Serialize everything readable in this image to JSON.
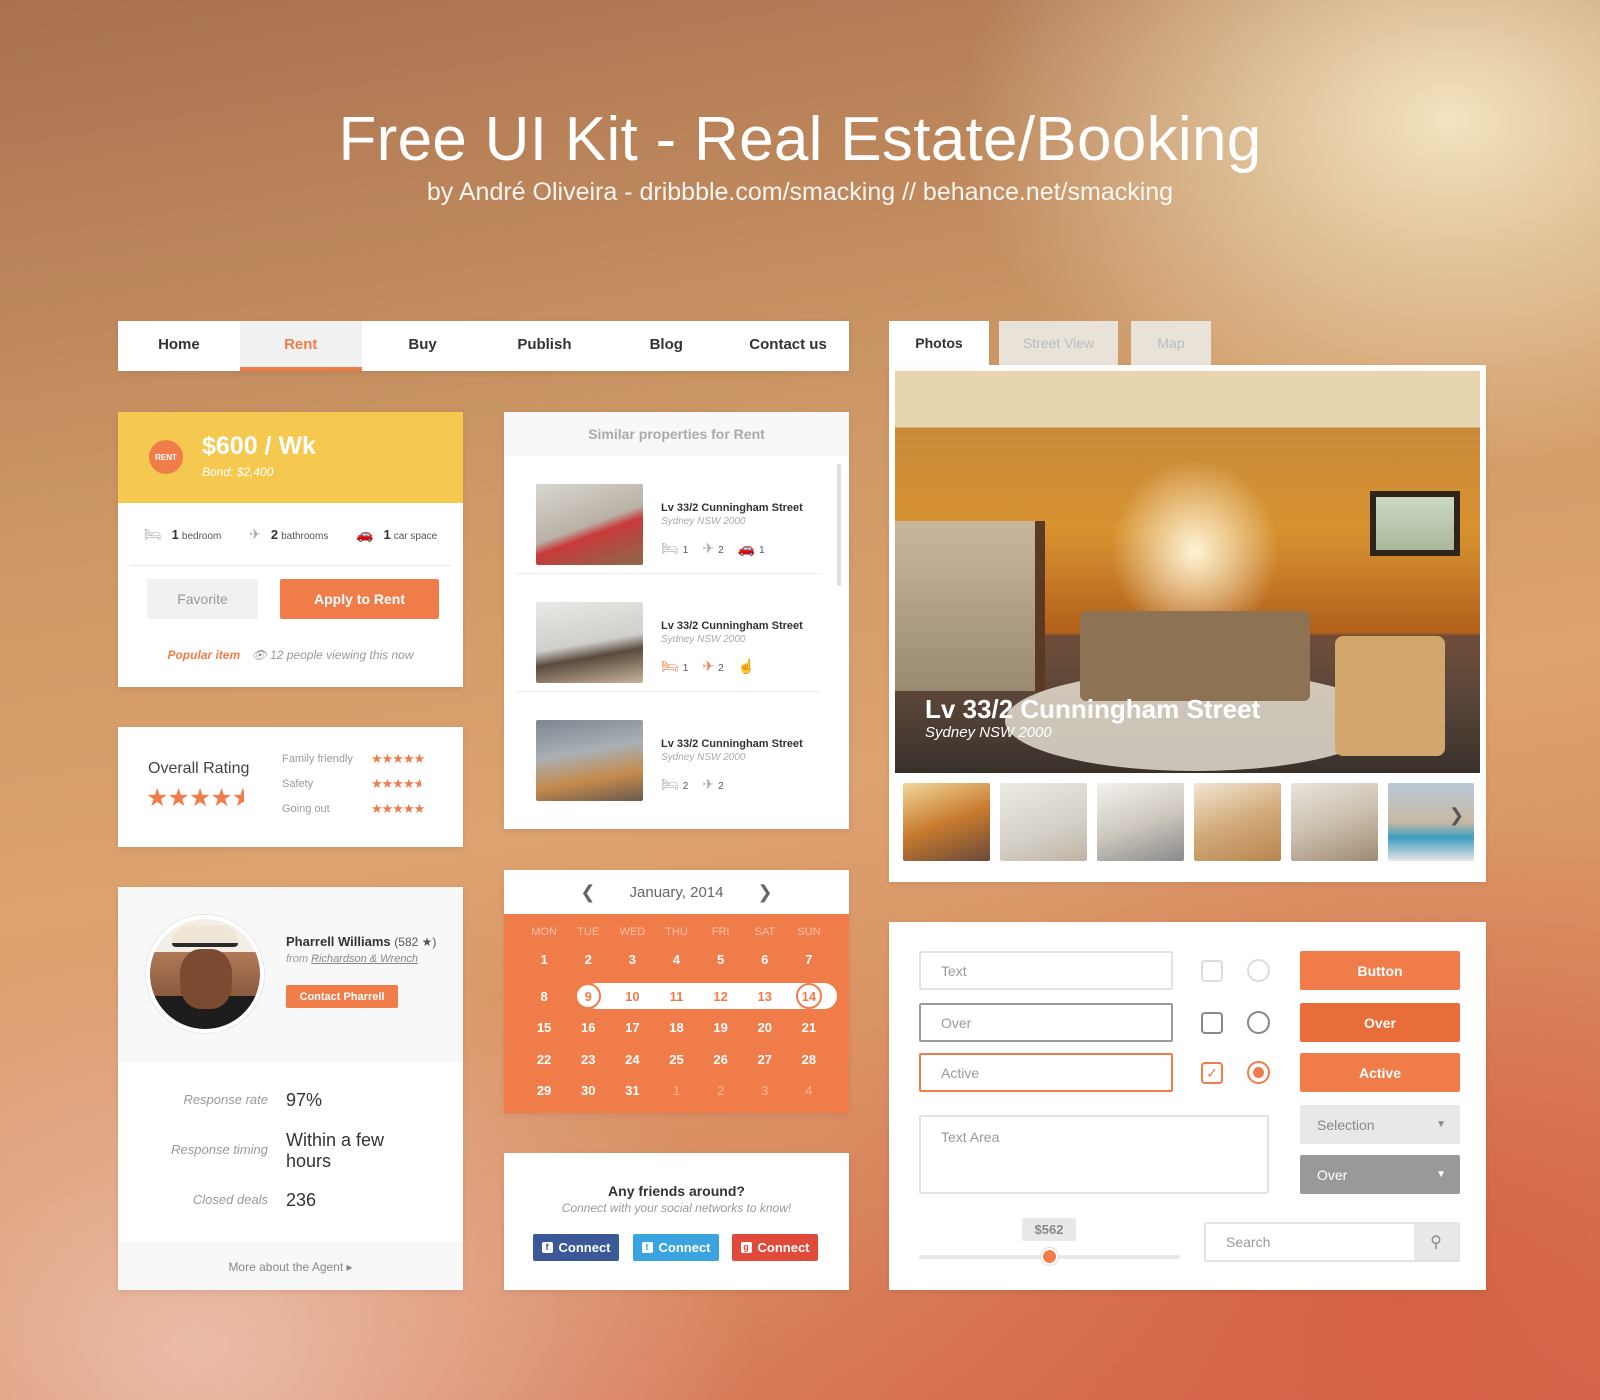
{
  "header": {
    "title": "Free UI Kit - Real Estate/Booking",
    "subtitle": "by André Oliveira - dribbble.com/smacking // behance.net/smacking"
  },
  "nav": {
    "items": [
      "Home",
      "Rent",
      "Buy",
      "Publish",
      "Blog",
      "Contact us"
    ],
    "active": "Rent"
  },
  "listing": {
    "badge": "RENT",
    "price": "$600 / Wk",
    "bond": "Bond: $2,400",
    "features": [
      {
        "icon": "bed-icon",
        "count": "1",
        "label": "bedroom"
      },
      {
        "icon": "shower-icon",
        "count": "2",
        "label": "bathrooms"
      },
      {
        "icon": "car-icon",
        "count": "1",
        "label": "car space"
      }
    ],
    "favorite_label": "Favorite",
    "apply_label": "Apply to Rent",
    "popular_label": "Popular item",
    "viewing_text": "12 people viewing this now"
  },
  "rating": {
    "title": "Overall Rating",
    "overall_stars": 4.5,
    "categories": [
      {
        "label": "Family friendly",
        "stars": 5
      },
      {
        "label": "Safety",
        "stars": 4.5
      },
      {
        "label": "Going out",
        "stars": 5
      }
    ]
  },
  "agent": {
    "name": "Pharrell Williams",
    "count": "(582 ★)",
    "from_prefix": "from",
    "agency": "Richardson & Wrench",
    "contact_label": "Contact Pharrell",
    "stats": [
      {
        "label": "Response rate",
        "value": "97%"
      },
      {
        "label": "Response timing",
        "value": "Within a few hours"
      },
      {
        "label": "Closed deals",
        "value": "236"
      }
    ],
    "more_label": "More about the Agent ▸"
  },
  "similar": {
    "title": "Similar properties for Rent",
    "items": [
      {
        "title": "Lv 33/2 Cunningham Street",
        "sub": "Sydney NSW 2000",
        "beds": "1",
        "baths": "2",
        "cars": "1"
      },
      {
        "title": "Lv 33/2 Cunningham Street",
        "sub": "Sydney NSW 2000",
        "beds": "1",
        "baths": "2",
        "cars": ""
      },
      {
        "title": "Lv 33/2 Cunningham Street",
        "sub": "Sydney NSW 2000",
        "beds": "2",
        "baths": "2",
        "cars": ""
      }
    ]
  },
  "calendar": {
    "month": "January, 2014",
    "weekdays": [
      "MON",
      "TUE",
      "WED",
      "THU",
      "FRI",
      "SAT",
      "SUN"
    ],
    "weeks": [
      [
        "1",
        "2",
        "3",
        "4",
        "5",
        "6",
        "7"
      ],
      [
        "8",
        "9",
        "10",
        "11",
        "12",
        "13",
        "14"
      ],
      [
        "15",
        "16",
        "17",
        "18",
        "19",
        "20",
        "21"
      ],
      [
        "22",
        "23",
        "24",
        "25",
        "26",
        "27",
        "28"
      ],
      [
        "29",
        "30",
        "31",
        "1",
        "2",
        "3",
        "4"
      ]
    ],
    "range_start": "9",
    "range_end": "14"
  },
  "friends": {
    "title": "Any friends around?",
    "subtitle": "Connect with your social networks to know!",
    "buttons": [
      {
        "label": "Connect",
        "network": "facebook",
        "color": "#3b5998"
      },
      {
        "label": "Connect",
        "network": "twitter",
        "color": "#3aa4e0"
      },
      {
        "label": "Connect",
        "network": "google-plus",
        "color": "#e04a3a"
      }
    ]
  },
  "gallery": {
    "tabs": [
      "Photos",
      "Street View",
      "Map"
    ],
    "active_tab": "Photos",
    "photo_title": "Lv 33/2 Cunningham Street",
    "photo_sub": "Sydney NSW 2000"
  },
  "form": {
    "inputs": [
      "Text",
      "Over",
      "Active"
    ],
    "textarea_placeholder": "Text Area",
    "buttons": [
      "Button",
      "Over",
      "Active"
    ],
    "selects": [
      "Selection",
      "Over"
    ],
    "slider_value": "$562",
    "search_placeholder": "Search"
  },
  "colors": {
    "accent": "#f07c4a",
    "yellow": "#f5c94f"
  }
}
